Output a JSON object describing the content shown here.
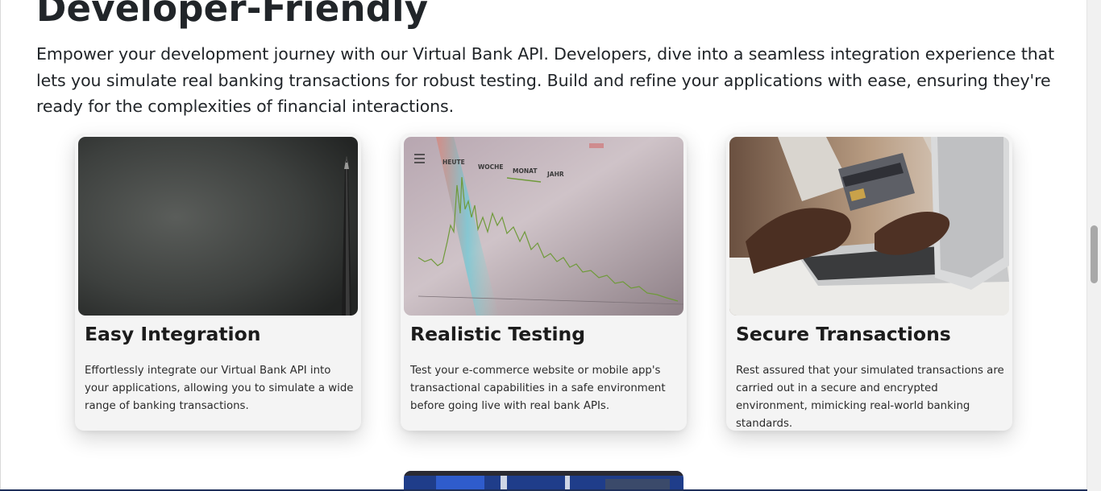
{
  "section": {
    "heading": "Developer-Friendly",
    "lead": "Empower your development journey with our Virtual Bank API. Developers, dive into a seamless integration experience that lets you simulate real banking transactions for robust testing. Build and refine your applications with ease, ensuring they're ready for the complexities of financial interactions."
  },
  "cards": [
    {
      "title": "Easy Integration",
      "text": "Effortlessly integrate our Virtual Bank API into your applications, allowing you to simulate a wide range of banking transactions.",
      "image": "dark-paper-with-pencil-photo"
    },
    {
      "title": "Realistic Testing",
      "text": "Test your e-commerce website or mobile app's transactional capabilities in a safe environment before going live with real bank APIs.",
      "image": "stock-chart-screen-photo",
      "image_tabs": [
        "HEUTE",
        "WOCHE",
        "MONAT",
        "JAHR"
      ]
    },
    {
      "title": "Secure Transactions",
      "text": "Rest assured that your simulated transactions are carried out in a secure and encrypted environment, mimicking real-world banking standards.",
      "image": "hand-holding-credit-card-laptop-photo"
    }
  ],
  "colors": {
    "card_bg": "#f4f4f4",
    "text": "#212529",
    "chart_line": "#6f9a3a"
  }
}
